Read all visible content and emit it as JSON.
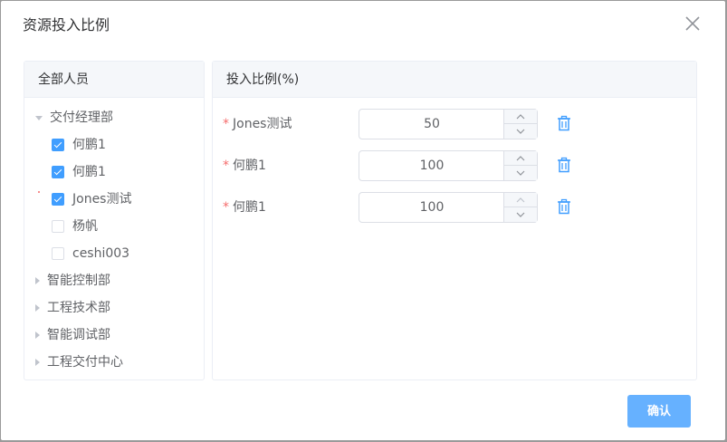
{
  "dialog": {
    "title": "资源投入比例",
    "confirm_label": "确认"
  },
  "left_panel": {
    "header": "全部人员",
    "expanded_group": "交付经理部",
    "members": [
      {
        "name": "何鹏1",
        "checked": true
      },
      {
        "name": "何鹏1",
        "checked": true
      },
      {
        "name": "Jones测试",
        "checked": true
      },
      {
        "name": "杨帆",
        "checked": false
      },
      {
        "name": "ceshi003",
        "checked": false
      }
    ],
    "collapsed_groups": [
      "智能控制部",
      "工程技术部",
      "智能调试部",
      "工程交付中心"
    ]
  },
  "right_panel": {
    "header": "投入比例(%)",
    "rows": [
      {
        "label": "Jones测试",
        "value": "50"
      },
      {
        "label": "何鹏1",
        "value": "100"
      },
      {
        "label": "何鹏1",
        "value": "100"
      }
    ]
  },
  "icons": {
    "close": "close-icon",
    "delete": "trash-icon",
    "increase": "chevron-up-icon",
    "decrease": "chevron-down-icon"
  },
  "colors": {
    "primary": "#409eff",
    "confirm_button": "#66b1ff",
    "required_star": "#f56c6c"
  }
}
